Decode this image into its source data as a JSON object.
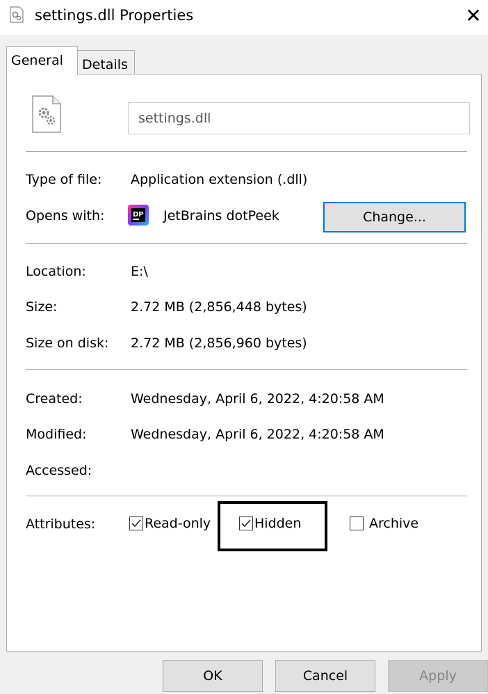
{
  "window": {
    "title": "settings.dll Properties",
    "close_label": "✕"
  },
  "tabs": [
    {
      "label": "General",
      "active": true
    },
    {
      "label": "Details",
      "active": false
    }
  ],
  "file": {
    "name": "settings.dll",
    "icon": "dll-file-icon"
  },
  "type_row": {
    "label": "Type of file:",
    "value": "Application extension (.dll)"
  },
  "opens_row": {
    "label": "Opens with:",
    "app_name": "JetBrains dotPeek",
    "app_icon": "dotpeek-icon",
    "change_label": "Change..."
  },
  "location_row": {
    "label": "Location:",
    "value": "E:\\"
  },
  "size_row": {
    "label": "Size:",
    "value": "2.72 MB (2,856,448 bytes)"
  },
  "disk_row": {
    "label": "Size on disk:",
    "value": "2.72 MB (2,856,960 bytes)"
  },
  "created_row": {
    "label": "Created:",
    "value": "Wednesday, April 6, 2022, 4:20:58 AM"
  },
  "modified_row": {
    "label": "Modified:",
    "value": "Wednesday, April 6, 2022, 4:20:58 AM"
  },
  "accessed_row": {
    "label": "Accessed:",
    "value": ""
  },
  "attributes": {
    "label": "Attributes:",
    "readonly": {
      "label": "Read-only",
      "checked": true
    },
    "hidden": {
      "label": "Hidden",
      "checked": true
    },
    "archive": {
      "label": "Archive",
      "checked": false
    }
  },
  "buttons": {
    "ok": "OK",
    "cancel": "Cancel",
    "apply": "Apply"
  },
  "colors": {
    "focus_border": "#0078d7",
    "dialog_bg": "#f0f0f0",
    "panel_bg": "#ffffff"
  }
}
